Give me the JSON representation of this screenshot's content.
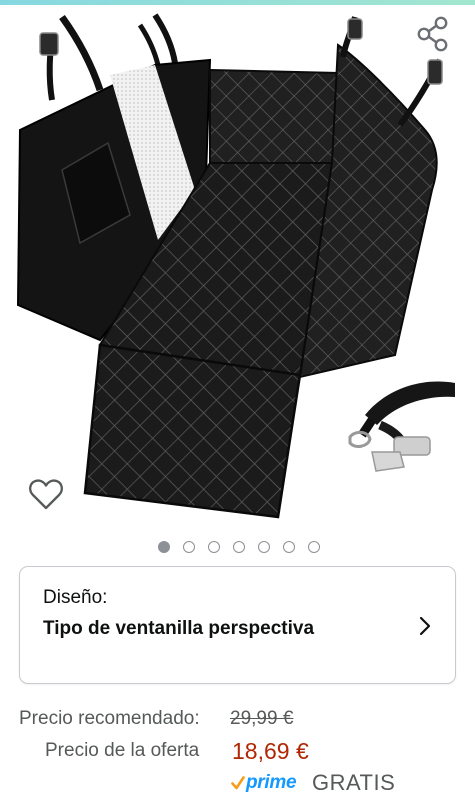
{
  "icons": {
    "share": "share-icon",
    "wishlist": "heart-outline-icon",
    "chevron": "chevron-right-icon",
    "prime_check": "prime-check-icon"
  },
  "image": {
    "description_name": "product-photo-dog-seat-cover",
    "dots_count": 7,
    "active_index": 0
  },
  "variant": {
    "label": "Diseño:",
    "value": "Tipo de ventanilla perspectiva"
  },
  "price": {
    "recommended_label": "Precio recomendado:",
    "recommended_value": "29,99 €",
    "offer_label": "Precio de la oferta",
    "offer_value": "18,69 €"
  },
  "shipping": {
    "prime_label": "prime",
    "shipping_text": "GRATIS"
  },
  "colors": {
    "price_red": "#b12704",
    "prime_blue": "#1399ff",
    "prime_check_orange": "#f79c1c",
    "secondary_text": "#565959",
    "card_border": "#c7cbcf"
  }
}
